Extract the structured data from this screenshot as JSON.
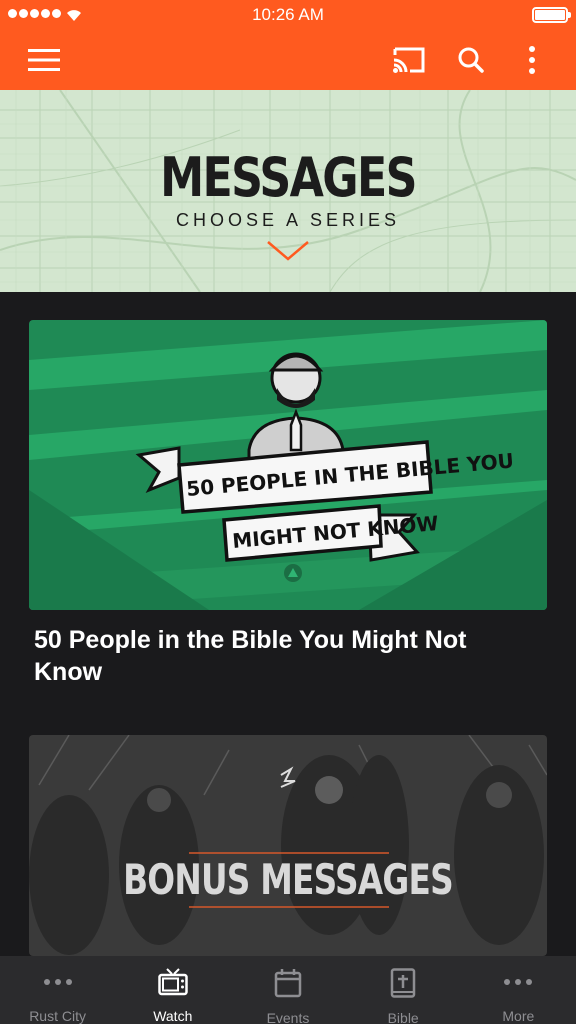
{
  "status_bar": {
    "time": "10:26 AM"
  },
  "app_bar": {
    "icons": [
      "hamburger-menu-icon",
      "cast-icon",
      "search-icon",
      "more-vertical-icon"
    ],
    "color": "#ff5a1f"
  },
  "hero": {
    "title": "MESSAGES",
    "subtitle": "CHOOSE A SERIES",
    "accent": "#ff5a1f"
  },
  "series": [
    {
      "title": "50 People in the Bible You Might Not Know",
      "art_line1": "50 PEOPLE IN THE BIBLE YOU",
      "art_line2": "MIGHT NOT KNOW"
    },
    {
      "title": "",
      "art_text": "BONUS MESSAGES"
    }
  ],
  "tabs": [
    {
      "label": "Rust City",
      "icon": "more-dots-icon",
      "active": false
    },
    {
      "label": "Watch",
      "icon": "tv-icon",
      "active": true
    },
    {
      "label": "Events",
      "icon": "calendar-icon",
      "active": false
    },
    {
      "label": "Bible",
      "icon": "bible-icon",
      "active": false
    },
    {
      "label": "More",
      "icon": "more-dots-icon",
      "active": false
    }
  ]
}
